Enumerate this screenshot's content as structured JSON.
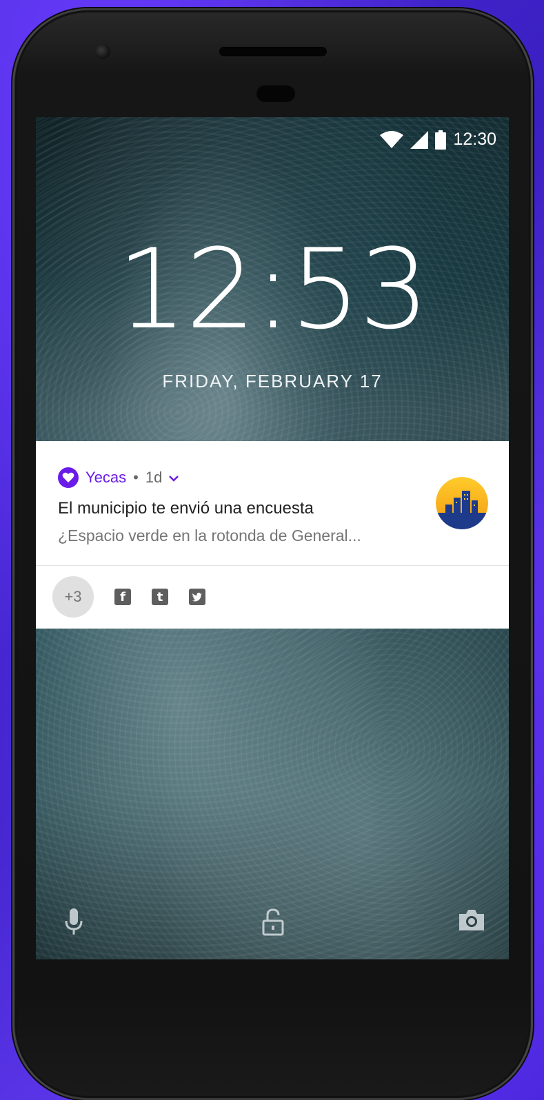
{
  "status_bar": {
    "time": "12:30",
    "icons": [
      "wifi-icon",
      "cell-signal-icon",
      "battery-icon"
    ]
  },
  "lockscreen": {
    "clock": "12:53",
    "date": "FRIDAY, FEBRUARY 17"
  },
  "notification": {
    "app_name": "Yecas",
    "separator": "•",
    "age": "1d",
    "title": "El municipio te envió una encuesta",
    "body": "¿Espacio verde en la rotonda de General...",
    "more_count": "+3",
    "social_icons": [
      "facebook-icon",
      "tumblr-icon",
      "twitter-icon"
    ],
    "accent_color": "#6a1be8"
  },
  "bottom_shortcuts": [
    "microphone-icon",
    "unlock-icon",
    "camera-icon"
  ]
}
